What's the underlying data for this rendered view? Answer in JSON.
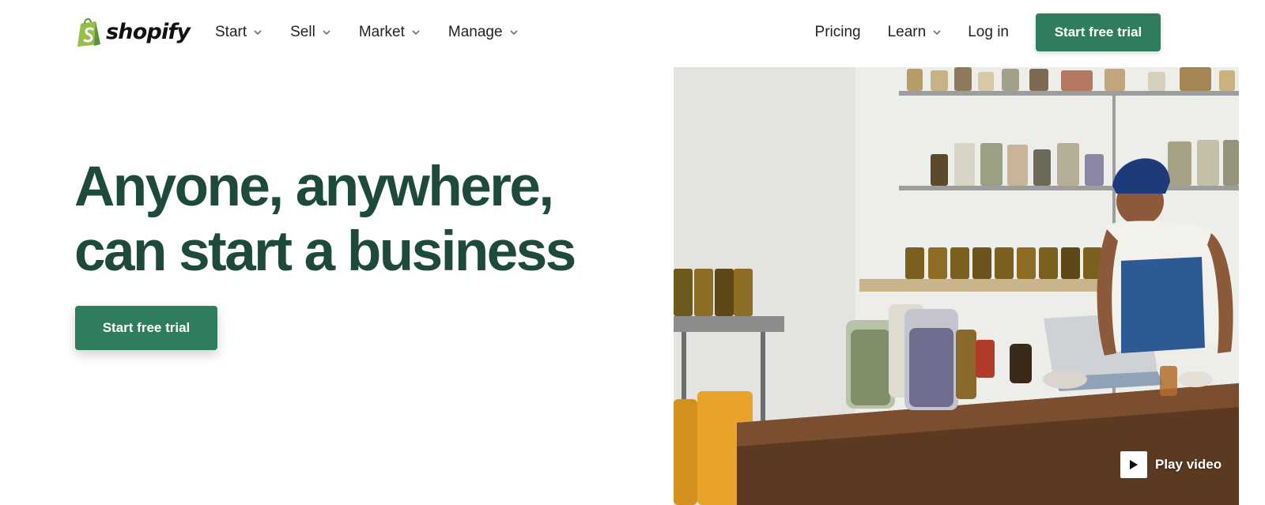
{
  "brand": {
    "name": "shopify",
    "accent": "#2f7d5e",
    "headline_color": "#1d4a3c",
    "logo_green": "#95bf47"
  },
  "nav": {
    "left": [
      {
        "label": "Start",
        "icon": "chevron-down-icon"
      },
      {
        "label": "Sell",
        "icon": "chevron-down-icon"
      },
      {
        "label": "Market",
        "icon": "chevron-down-icon"
      },
      {
        "label": "Manage",
        "icon": "chevron-down-icon"
      }
    ],
    "pricing": "Pricing",
    "learn": {
      "label": "Learn",
      "icon": "chevron-down-icon"
    },
    "login": "Log in",
    "cta": "Start free trial"
  },
  "hero": {
    "headline_line1": "Anyone, anywhere,",
    "headline_line2": "can start a business",
    "cta": "Start free trial",
    "video": {
      "label": "Play video",
      "icon": "play-icon"
    }
  }
}
